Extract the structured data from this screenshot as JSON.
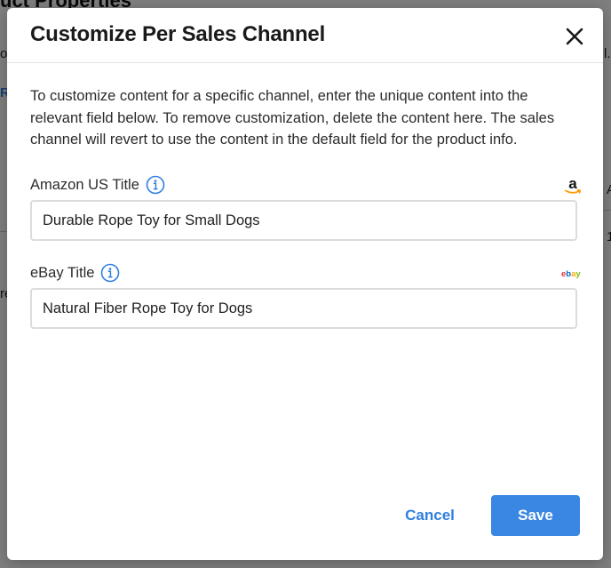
{
  "background": {
    "title": "uct Properties",
    "fragments": [
      "o",
      "R",
      "l.",
      "A",
      "1",
      "re"
    ]
  },
  "modal": {
    "title": "Customize Per Sales Channel",
    "description": "To customize content for a specific channel, enter the unique content into the relevant field below. To remove customization, delete the content here. The sales channel will revert to use the content in the default field for the product info.",
    "fields": [
      {
        "label": "Amazon US Title",
        "value": "Durable Rope Toy for Small Dogs",
        "channel_icon": "amazon-logo-icon"
      },
      {
        "label": "eBay Title",
        "value": "Natural Fiber Rope Toy for Dogs",
        "channel_icon": "ebay-logo-icon"
      }
    ],
    "cancel_label": "Cancel",
    "save_label": "Save",
    "ebay_logo_text": [
      "e",
      "b",
      "a",
      "y"
    ],
    "amazon_logo_text": "a"
  },
  "colors": {
    "accent": "#3a86e3",
    "ebay": [
      "#e53238",
      "#0064d2",
      "#f5af02",
      "#86b817"
    ],
    "amazon_smile": "#ff9900"
  }
}
